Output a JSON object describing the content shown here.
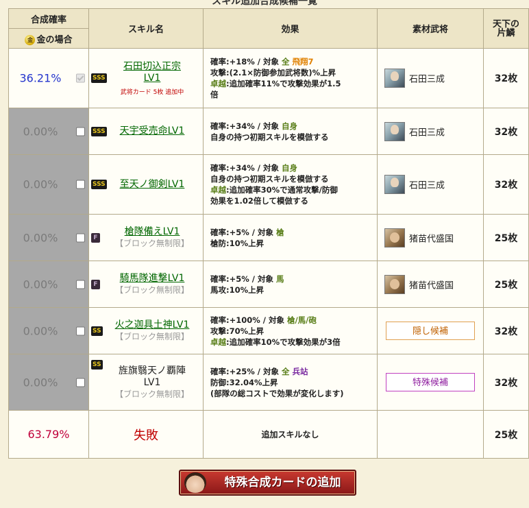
{
  "page_title": "スキル追加合成候補一覧",
  "header": {
    "rate": "合成確率",
    "gold_label": "金の場合",
    "gold_coin": "金",
    "skill": "スキル名",
    "effect": "効果",
    "material": "素材武将",
    "cards_line1": "天下の",
    "cards_line2": "片鱗"
  },
  "rows": [
    {
      "rate": "36.21%",
      "badge": "SSS",
      "skill": "石田切込正宗LV1",
      "note": "武将カード 5枚 追加中",
      "effect_lines": [
        [
          "確率:+18% / 対象 ",
          {
            "t": "全 ",
            "c": "g"
          },
          {
            "t": "飛翔7",
            "c": "o"
          }
        ],
        [
          "攻撃:(2.1×防御参加武将数)%上昇"
        ],
        [
          {
            "t": "卓越",
            "c": "g"
          },
          ":追加確率11%で攻撃効果が1.5"
        ],
        [
          "倍"
        ]
      ],
      "material_name": "石田三成",
      "cards": "32枚"
    },
    {
      "rate": "0.00%",
      "badge": "SSS",
      "skill": "天宇受売命LV1",
      "effect_lines": [
        [
          "確率:+34% / 対象 ",
          {
            "t": "自身",
            "c": "g"
          }
        ],
        [
          "自身の持つ初期スキルを模倣する"
        ]
      ],
      "material_name": "石田三成",
      "cards": "32枚"
    },
    {
      "rate": "0.00%",
      "badge": "SSS",
      "skill": "至天ノ御剣LV1",
      "effect_lines": [
        [
          "確率:+34% / 対象 ",
          {
            "t": "自身",
            "c": "g"
          }
        ],
        [
          "自身の持つ初期スキルを模倣する"
        ],
        [
          {
            "t": "卓越",
            "c": "g"
          },
          ":追加確率30%で通常攻撃/防御"
        ],
        [
          "効果を1.02倍して模倣する"
        ]
      ],
      "material_name": "石田三成",
      "cards": "32枚"
    },
    {
      "rate": "0.00%",
      "badge": "F",
      "skill": "槍隊備えLV1",
      "block": "【ブロック無制限】",
      "effect_lines": [
        [
          "確率:+5% / 対象 ",
          {
            "t": "槍",
            "c": "g"
          }
        ],
        [
          "槍防:10%上昇"
        ]
      ],
      "material_name": "猪苗代盛国",
      "cards": "25枚"
    },
    {
      "rate": "0.00%",
      "badge": "F",
      "skill": "騎馬隊進撃LV1",
      "block": "【ブロック無制限】",
      "effect_lines": [
        [
          "確率:+5% / 対象 ",
          {
            "t": "馬",
            "c": "g"
          }
        ],
        [
          "馬攻:10%上昇"
        ]
      ],
      "material_name": "猪苗代盛国",
      "cards": "25枚"
    },
    {
      "rate": "0.00%",
      "badge": "SS",
      "skill": "火之迦具土神LV1",
      "block": "【ブロック無制限】",
      "effect_lines": [
        [
          "確率:+100% / 対象 ",
          {
            "t": "槍/馬/砲",
            "c": "g"
          }
        ],
        [
          "攻撃:70%上昇"
        ],
        [
          {
            "t": "卓越",
            "c": "g"
          },
          ":追加確率10%で攻撃効果が3倍"
        ]
      ],
      "material_box": "隠し候補",
      "cards": "32枚"
    },
    {
      "rate": "0.00%",
      "badge": "SS",
      "skill_line1": "旌旗翳天ノ覇陣",
      "skill_line2": "LV1",
      "block": "【ブロック無制限】",
      "effect_lines": [
        [
          "確率:+25% / 対象 ",
          {
            "t": "全 ",
            "c": "g"
          },
          {
            "t": "兵站",
            "c": "p"
          }
        ],
        [
          "防御:32.04%上昇"
        ],
        [
          "(部隊の総コストで効果が変化します)"
        ]
      ],
      "material_box": "特殊候補",
      "cards": "32枚"
    }
  ],
  "fail_row": {
    "rate": "63.79%",
    "label": "失敗",
    "effect": "追加スキルなし",
    "cards": "25枚"
  },
  "button": {
    "label": "特殊合成カードの追加"
  }
}
